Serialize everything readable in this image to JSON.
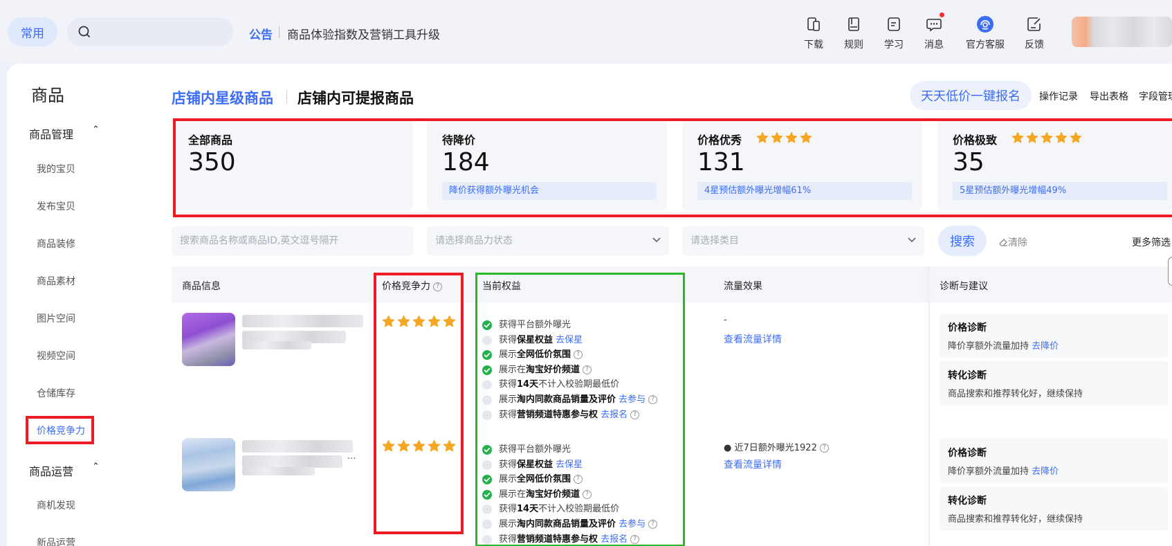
{
  "header": {
    "common_label": "常用",
    "notice_tag": "公告",
    "notice_text": "商品体验指数及营销工具升级",
    "tools": [
      {
        "label": "下载",
        "icon": "phone-download-icon"
      },
      {
        "label": "规则",
        "icon": "rules-book-icon"
      },
      {
        "label": "学习",
        "icon": "learn-doc-icon"
      },
      {
        "label": "消息",
        "icon": "message-chat-icon"
      },
      {
        "label": "官方客服",
        "icon": "customer-service-icon"
      },
      {
        "label": "反馈",
        "icon": "feedback-edit-icon"
      }
    ]
  },
  "sidebar": {
    "title": "商品",
    "group1": "商品管理",
    "items1": [
      "我的宝贝",
      "发布宝贝",
      "商品装修",
      "商品素材",
      "图片空间",
      "视频空间",
      "仓储库存",
      "价格竞争力"
    ],
    "group2": "商品运营",
    "items2": [
      "商机发现",
      "新品运营"
    ],
    "active_item": "价格竞争力"
  },
  "tabs": {
    "active": "店铺内星级商品",
    "inactive": "店铺内可提报商品"
  },
  "actions": {
    "cta": "天天低价一键报名",
    "links": [
      "操作记录",
      "导出表格",
      "字段管理"
    ]
  },
  "summary_cards": [
    {
      "label": "全部商品",
      "value": "350",
      "stars": 0,
      "hint": ""
    },
    {
      "label": "待降价",
      "value": "184",
      "stars": 0,
      "hint": "降价获得额外曝光机会"
    },
    {
      "label": "价格优秀",
      "value": "131",
      "stars": 4,
      "hint": "4星预估额外曝光增幅61%"
    },
    {
      "label": "价格极致",
      "value": "35",
      "stars": 5,
      "hint": "5星预估额外曝光增幅49%"
    }
  ],
  "filters": {
    "search_placeholder": "搜索商品名称或商品ID,英文逗号隔开",
    "status_placeholder": "请选择商品力状态",
    "category_placeholder": "请选择类目",
    "search_button": "搜索",
    "clear_button": "清除",
    "more_filters": "更多筛选"
  },
  "table": {
    "headers": {
      "product": "商品信息",
      "price_comp": "价格竞争力",
      "benefits": "当前权益",
      "traffic": "流量效果",
      "diagnosis": "诊断与建议"
    },
    "rows": [
      {
        "stars": 5,
        "thumb_caption": "",
        "traffic_value": "-",
        "traffic_stat": "",
        "traffic_link": "查看流量详情",
        "benefits": [
          {
            "on": true,
            "pre": "获得平台额外曝光",
            "bold": "",
            "post": "",
            "help": false,
            "link": ""
          },
          {
            "on": false,
            "pre": "获得",
            "bold": "保星权益",
            "post": "",
            "help": false,
            "link": "去保星"
          },
          {
            "on": true,
            "pre": "展示",
            "bold": "全网低价氛围",
            "post": "",
            "help": true,
            "link": ""
          },
          {
            "on": true,
            "pre": "展示在",
            "bold": "淘宝好价频道",
            "post": "",
            "help": true,
            "link": ""
          },
          {
            "on": false,
            "pre": "获得",
            "bold": "14天",
            "post": "不计入校验期最低价",
            "help": false,
            "link": ""
          },
          {
            "on": false,
            "pre": "展示",
            "bold": "淘内同款商品销量及评价",
            "post": "",
            "help": true,
            "link": "去参与"
          },
          {
            "on": false,
            "pre": "获得",
            "bold": "营销频道特惠参与权",
            "post": "",
            "help": true,
            "link": "去报名"
          }
        ],
        "diagnosis": [
          {
            "title": "价格诊断",
            "desc": "降价享额外流量加持",
            "link": "去降价"
          },
          {
            "title": "转化诊断",
            "desc": "商品搜索和推荐转化好，继续保持",
            "link": ""
          }
        ]
      },
      {
        "stars": 5,
        "thumb_caption": "",
        "traffic_value": "",
        "traffic_stat": "近7日额外曝光1922",
        "traffic_link": "查看流量详情",
        "benefits": [
          {
            "on": true,
            "pre": "获得平台额外曝光",
            "bold": "",
            "post": "",
            "help": false,
            "link": ""
          },
          {
            "on": false,
            "pre": "获得",
            "bold": "保星权益",
            "post": "",
            "help": false,
            "link": "去保星"
          },
          {
            "on": true,
            "pre": "展示",
            "bold": "全网低价氛围",
            "post": "",
            "help": true,
            "link": ""
          },
          {
            "on": true,
            "pre": "展示在",
            "bold": "淘宝好价频道",
            "post": "",
            "help": true,
            "link": ""
          },
          {
            "on": false,
            "pre": "获得",
            "bold": "14天",
            "post": "不计入校验期最低价",
            "help": false,
            "link": ""
          },
          {
            "on": false,
            "pre": "展示",
            "bold": "淘内同款商品销量及评价",
            "post": "",
            "help": true,
            "link": "去参与"
          },
          {
            "on": false,
            "pre": "获得",
            "bold": "营销频道特惠参与权",
            "post": "",
            "help": true,
            "link": "去报名"
          }
        ],
        "diagnosis": [
          {
            "title": "价格诊断",
            "desc": "降价享额外流量加持",
            "link": "去降价"
          },
          {
            "title": "转化诊断",
            "desc": "商品搜索和推荐转化好，继续保持",
            "link": ""
          }
        ]
      }
    ]
  },
  "colors": {
    "accent": "#3d6df4",
    "highlight_red": "#ee1b24",
    "highlight_green": "#28b928",
    "star": "#f5a623",
    "check": "#22b14c"
  }
}
